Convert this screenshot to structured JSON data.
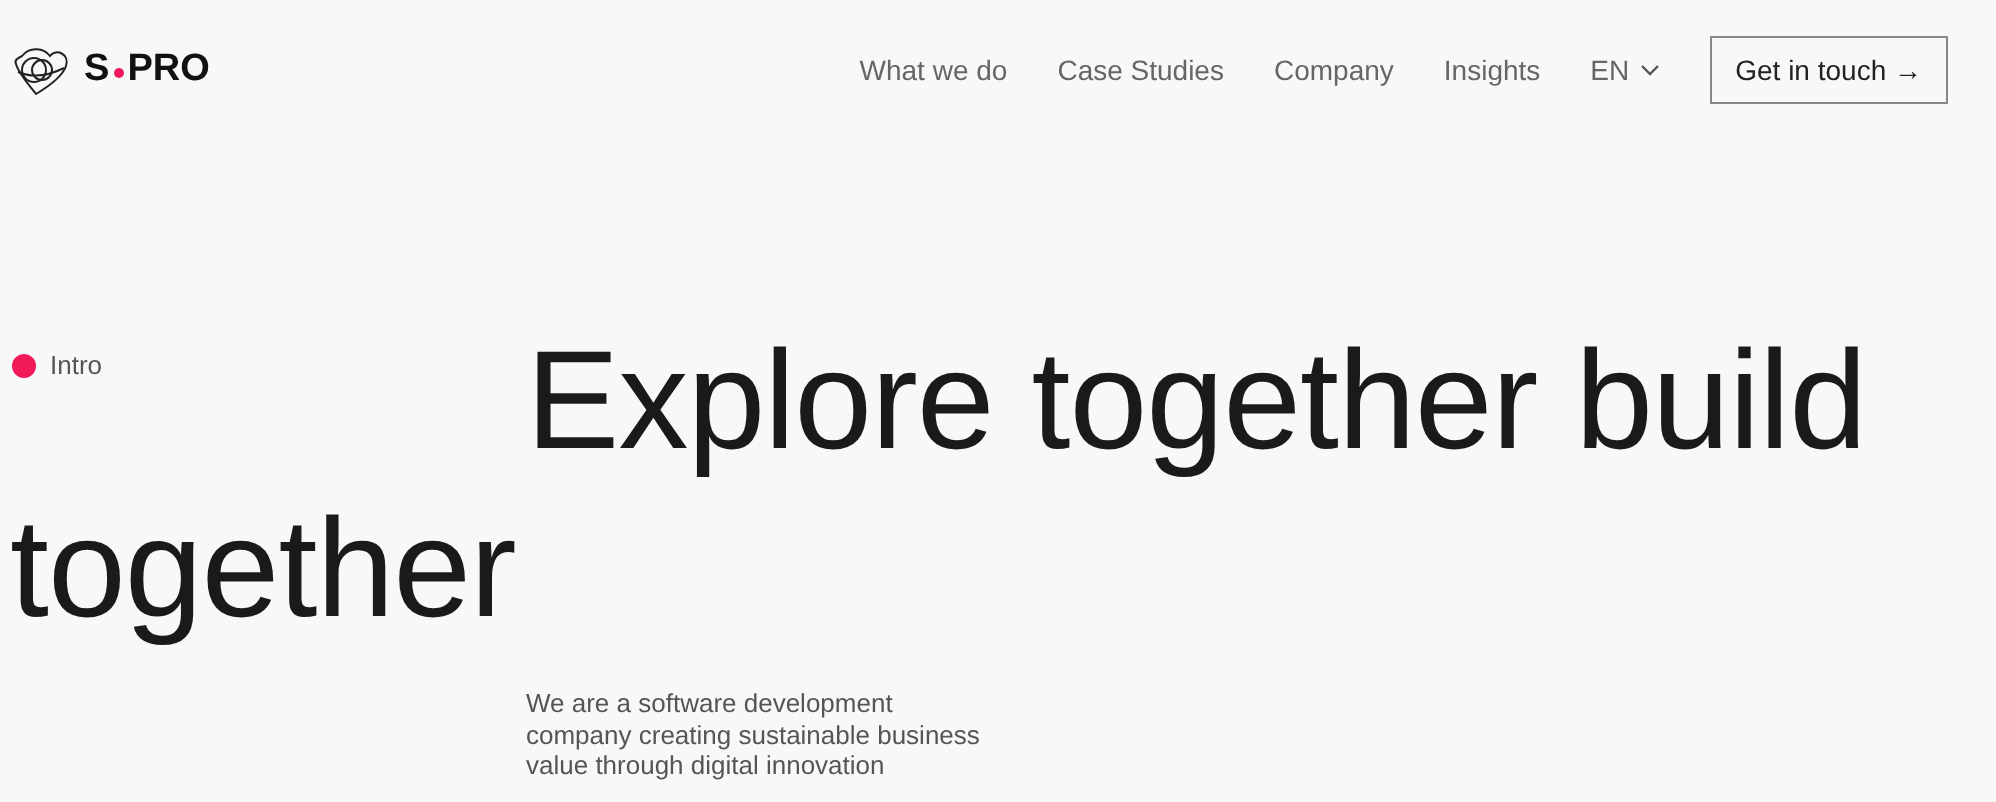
{
  "header": {
    "logo": {
      "left": "S",
      "right": "PRO"
    },
    "nav": [
      {
        "label": "What we do",
        "kind": "link"
      },
      {
        "label": "Case Studies",
        "kind": "link"
      },
      {
        "label": "Company",
        "kind": "link"
      },
      {
        "label": "Insights",
        "kind": "link"
      },
      {
        "label": "EN",
        "kind": "dropdown"
      }
    ],
    "cta": {
      "label": "Get in touch",
      "icon": "→"
    }
  },
  "hero": {
    "section_label": {
      "text": "Intro",
      "color": "#f0195a"
    },
    "headline_lines": [
      "Explore together build",
      "together"
    ],
    "description": "We are a software development company creating sustainable business value through digital innovation"
  }
}
